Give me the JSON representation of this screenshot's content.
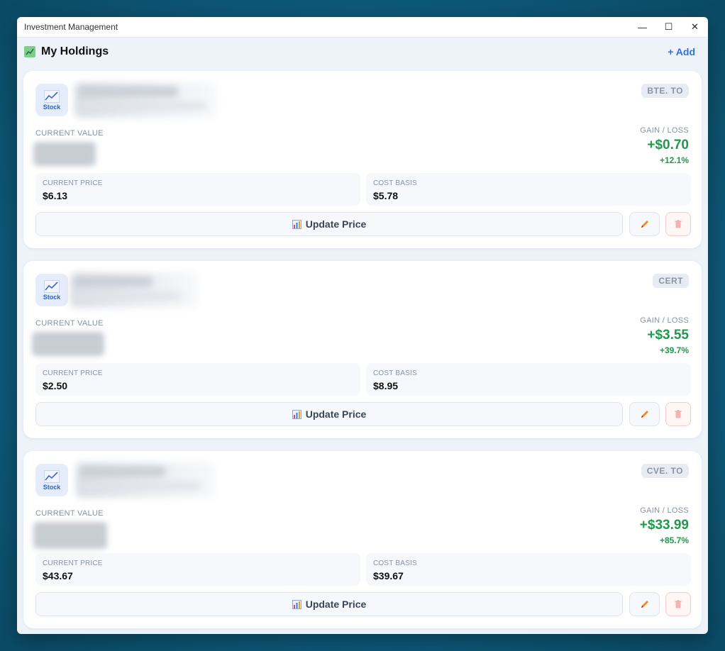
{
  "window": {
    "title": "Investment Management"
  },
  "header": {
    "title": "My Holdings",
    "add_label": "+ Add"
  },
  "labels": {
    "type": "Stock",
    "current_value": "CURRENT VALUE",
    "gain_loss": "GAIN / LOSS",
    "current_price": "CURRENT PRICE",
    "cost_basis": "COST BASIS",
    "update_price": "Update Price"
  },
  "colors": {
    "gain": "#1e9a4a",
    "accent": "#2f6fe0",
    "delete": "#e66a6a"
  },
  "holdings": [
    {
      "ticker": "BTE. TO",
      "gain_amount": "+$0.70",
      "gain_pct": "+12.1%",
      "current_price": "$6.13",
      "cost_basis": "$5.78"
    },
    {
      "ticker": "CERT",
      "gain_amount": "+$3.55",
      "gain_pct": "+39.7%",
      "current_price": "$2.50",
      "cost_basis": "$8.95"
    },
    {
      "ticker": "CVE. TO",
      "gain_amount": "+$33.99",
      "gain_pct": "+85.7%",
      "current_price": "$43.67",
      "cost_basis": "$39.67"
    }
  ]
}
